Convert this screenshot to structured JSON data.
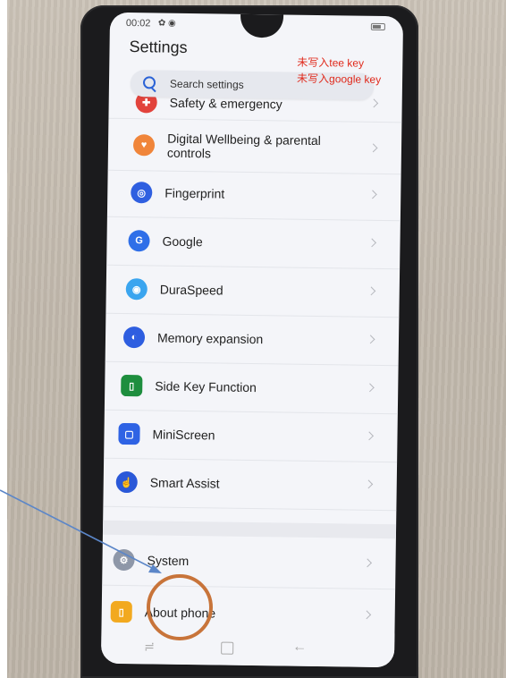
{
  "status": {
    "time": "00:02",
    "icons": "✿ ◉"
  },
  "header": {
    "title": "Settings"
  },
  "overlay_notes": [
    "未写入tee key",
    "未写入google key"
  ],
  "search": {
    "placeholder": "Search settings"
  },
  "items": [
    {
      "label": "Safety & emergency",
      "icon": "safety-icon",
      "color": "#e2433c"
    },
    {
      "label": "Digital Wellbeing & parental controls",
      "icon": "wellbeing-icon",
      "color": "#f0853a"
    },
    {
      "label": "Fingerprint",
      "icon": "fingerprint-icon",
      "color": "#2f5fe0"
    },
    {
      "label": "Google",
      "icon": "google-icon",
      "color": "#2f6fe8"
    },
    {
      "label": "DuraSpeed",
      "icon": "duraspeed-icon",
      "color": "#3aa5ef"
    },
    {
      "label": "Memory expansion",
      "icon": "memory-icon",
      "color": "#2e5ee0"
    },
    {
      "label": "Side Key Function",
      "icon": "side-key-icon",
      "color": "#1e8e3e"
    },
    {
      "label": "MiniScreen",
      "icon": "miniscreen-icon",
      "color": "#2f63e4"
    },
    {
      "label": "Smart Assist",
      "icon": "smart-assist-icon",
      "color": "#2a58d8"
    },
    {
      "label": "System",
      "icon": "system-icon",
      "color": "#8e97a8"
    },
    {
      "label": "About phone",
      "icon": "about-phone-icon",
      "color": "#f2a91f"
    }
  ],
  "annotation": {
    "arrow_color": "#5b86c8",
    "circle_color": "#c8743a"
  }
}
